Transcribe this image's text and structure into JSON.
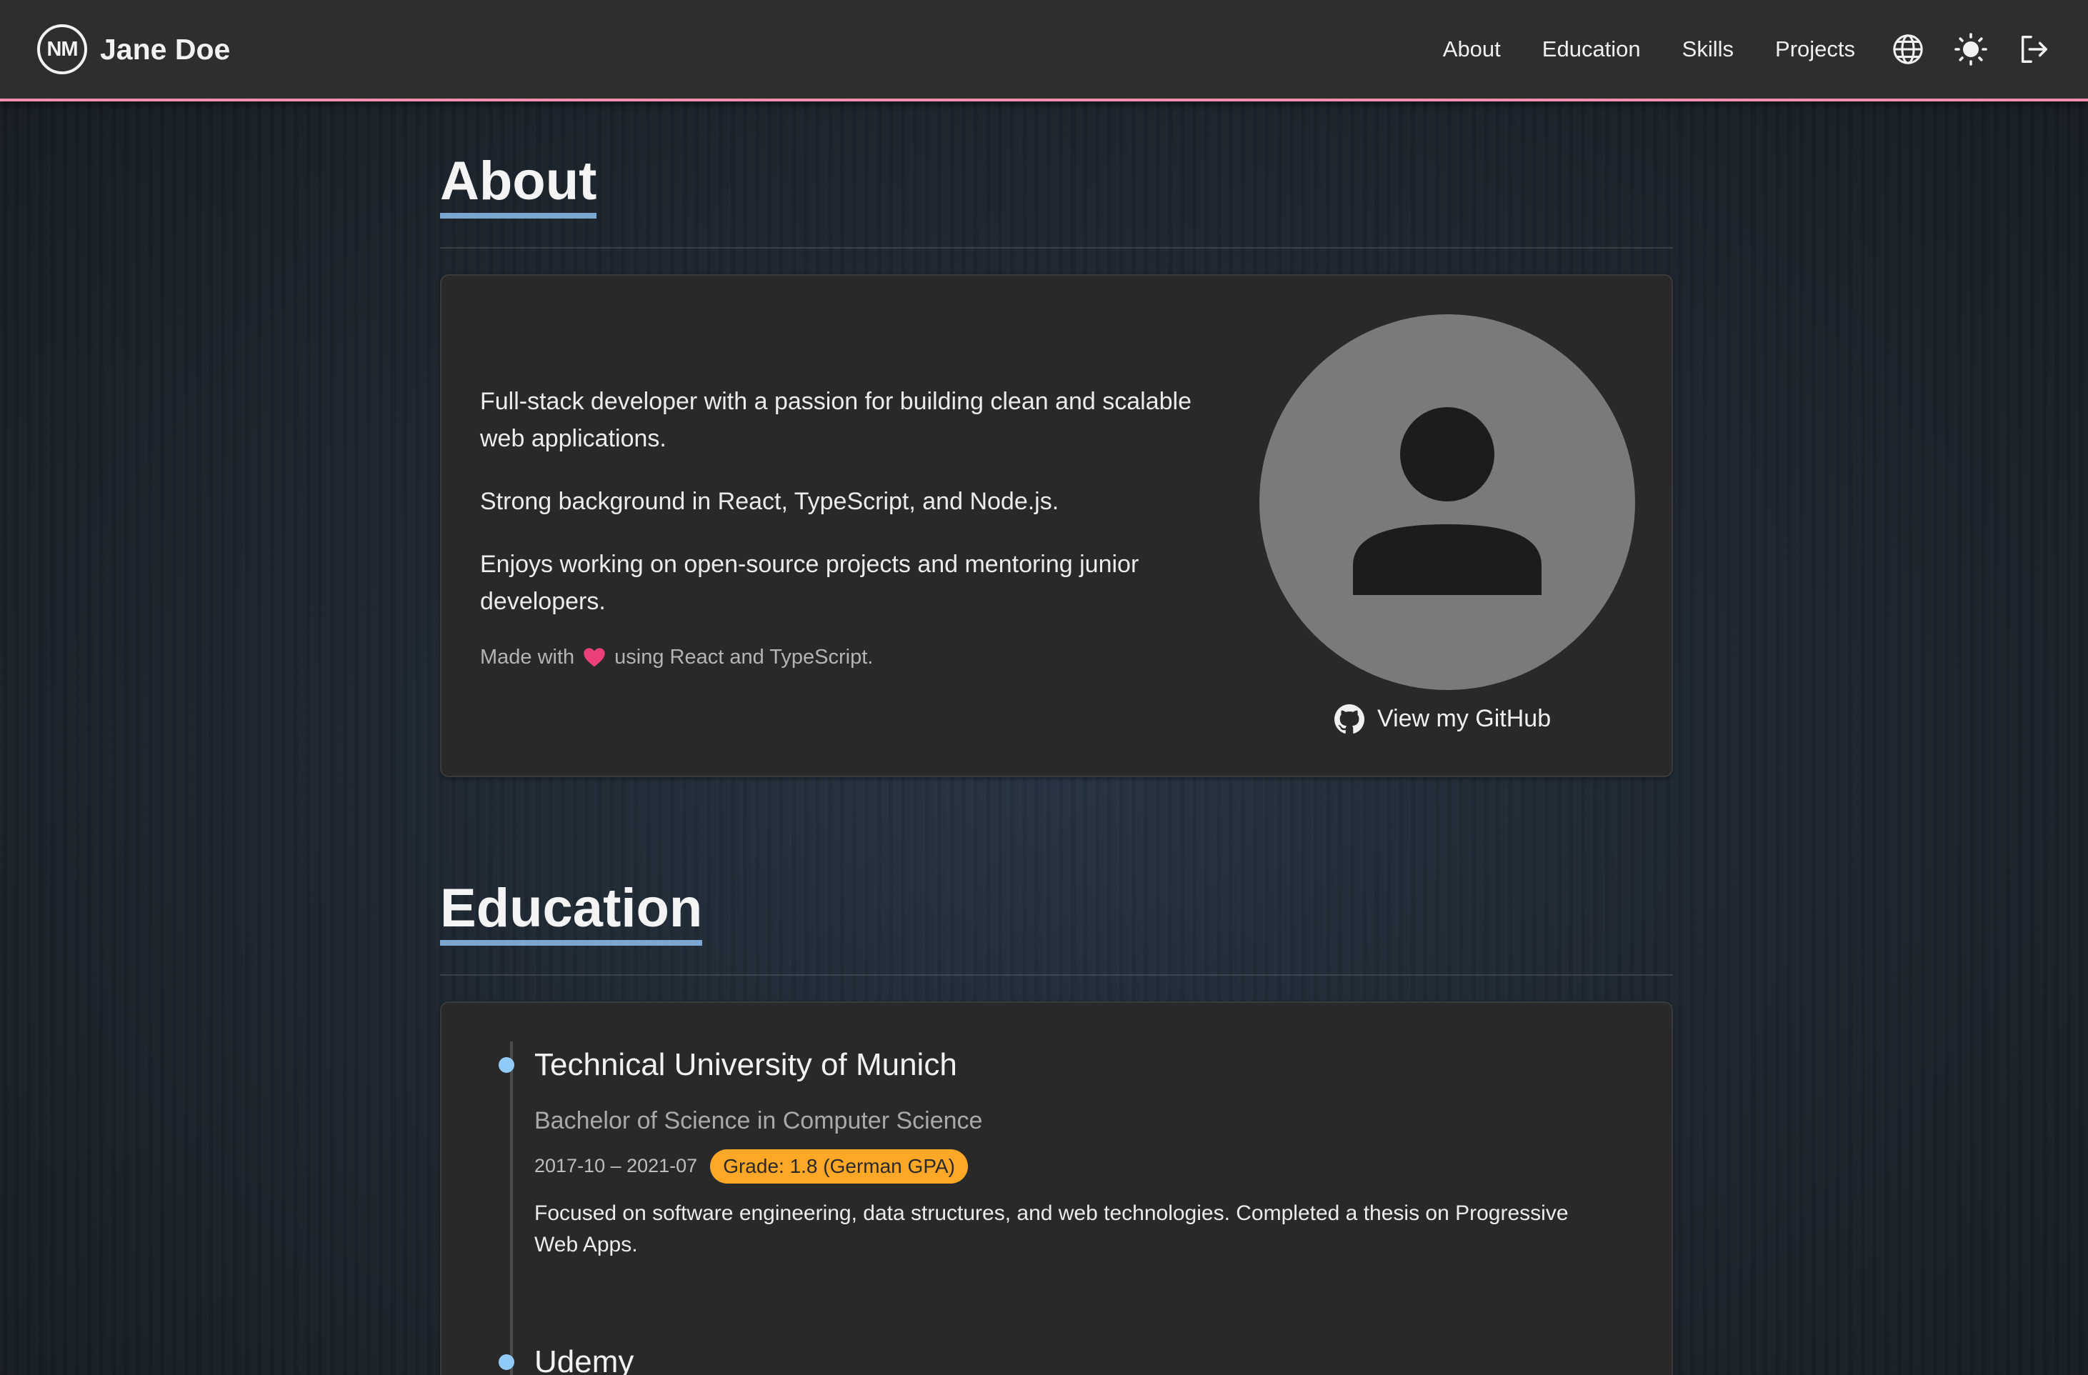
{
  "header": {
    "logo_initials": "NM",
    "name": "Jane Doe",
    "nav": [
      "About",
      "Education",
      "Skills",
      "Projects"
    ]
  },
  "about": {
    "title": "About",
    "paragraphs": [
      "Full-stack developer with a passion for building clean and scalable web applications.",
      "Strong background in React, TypeScript, and Node.js.",
      "Enjoys working on open-source projects and mentoring junior developers."
    ],
    "made_with_prefix": "Made with",
    "made_with_suffix": "using React and TypeScript.",
    "github_label": "View my GitHub"
  },
  "education": {
    "title": "Education",
    "items": [
      {
        "school": "Technical University of Munich",
        "degree": "Bachelor of Science in Computer Science",
        "dates": "2017-10 – 2021-07",
        "grade": "Grade: 1.8 (German GPA)",
        "description": "Focused on software engineering, data structures, and web technologies. Completed a thesis on Progressive Web Apps."
      },
      {
        "school": "Udemy"
      }
    ]
  },
  "icons": {
    "language": "globe-icon",
    "theme": "sun-icon",
    "logout": "logout-icon",
    "github": "github-icon",
    "heart": "heart-icon"
  },
  "colors": {
    "accent_border": "#f48fb1",
    "title_underline": "#7aa6cf",
    "timeline_dot": "#90caf9",
    "grade_badge": "#ffa726"
  }
}
